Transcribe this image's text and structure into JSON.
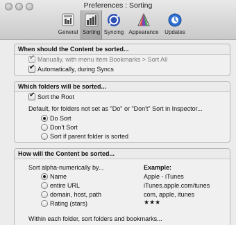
{
  "window": {
    "title": "Preferences : Sorting"
  },
  "toolbar": {
    "items": [
      {
        "label": "General",
        "icon": "general-icon"
      },
      {
        "label": "Sorting",
        "icon": "sorting-icon",
        "selected": true
      },
      {
        "label": "Syncing",
        "icon": "syncing-icon"
      },
      {
        "label": "Appearance",
        "icon": "appearance-icon"
      },
      {
        "label": "Updates",
        "icon": "updates-icon"
      }
    ]
  },
  "when_section": {
    "title": "When should the Content be sorted...",
    "manually": {
      "label": "Manually, with menu item Bookmarks > Sort All",
      "checked": true,
      "disabled": true
    },
    "automatically": {
      "label": "Automatically, during Syncs",
      "checked": true
    }
  },
  "which_section": {
    "title": "Which folders will be sorted...",
    "sort_root": {
      "label": "Sort the Root",
      "checked": true
    },
    "default_label": "Default, for folders not set as \"Do\" or \"Don't\" Sort in Inspector...",
    "options": [
      {
        "label": "Do Sort",
        "checked": true
      },
      {
        "label": "Don't Sort",
        "checked": false
      },
      {
        "label": "Sort if parent folder is sorted",
        "checked": false
      }
    ]
  },
  "how_section": {
    "title": "How will the Content be sorted...",
    "sort_by_label": "Sort alpha-numerically by...",
    "example_header": "Example:",
    "options": [
      {
        "label": "Name",
        "example": "Apple - iTunes",
        "checked": true
      },
      {
        "label": "entire URL",
        "example": "iTunes.apple.com/tunes",
        "checked": false
      },
      {
        "label": "domain, host, path",
        "example": "com, apple, itunes",
        "checked": false
      },
      {
        "label": "Rating (stars)",
        "example": "★★★",
        "checked": false
      }
    ],
    "within_label": "Within each folder, sort folders and bookmarks..."
  }
}
